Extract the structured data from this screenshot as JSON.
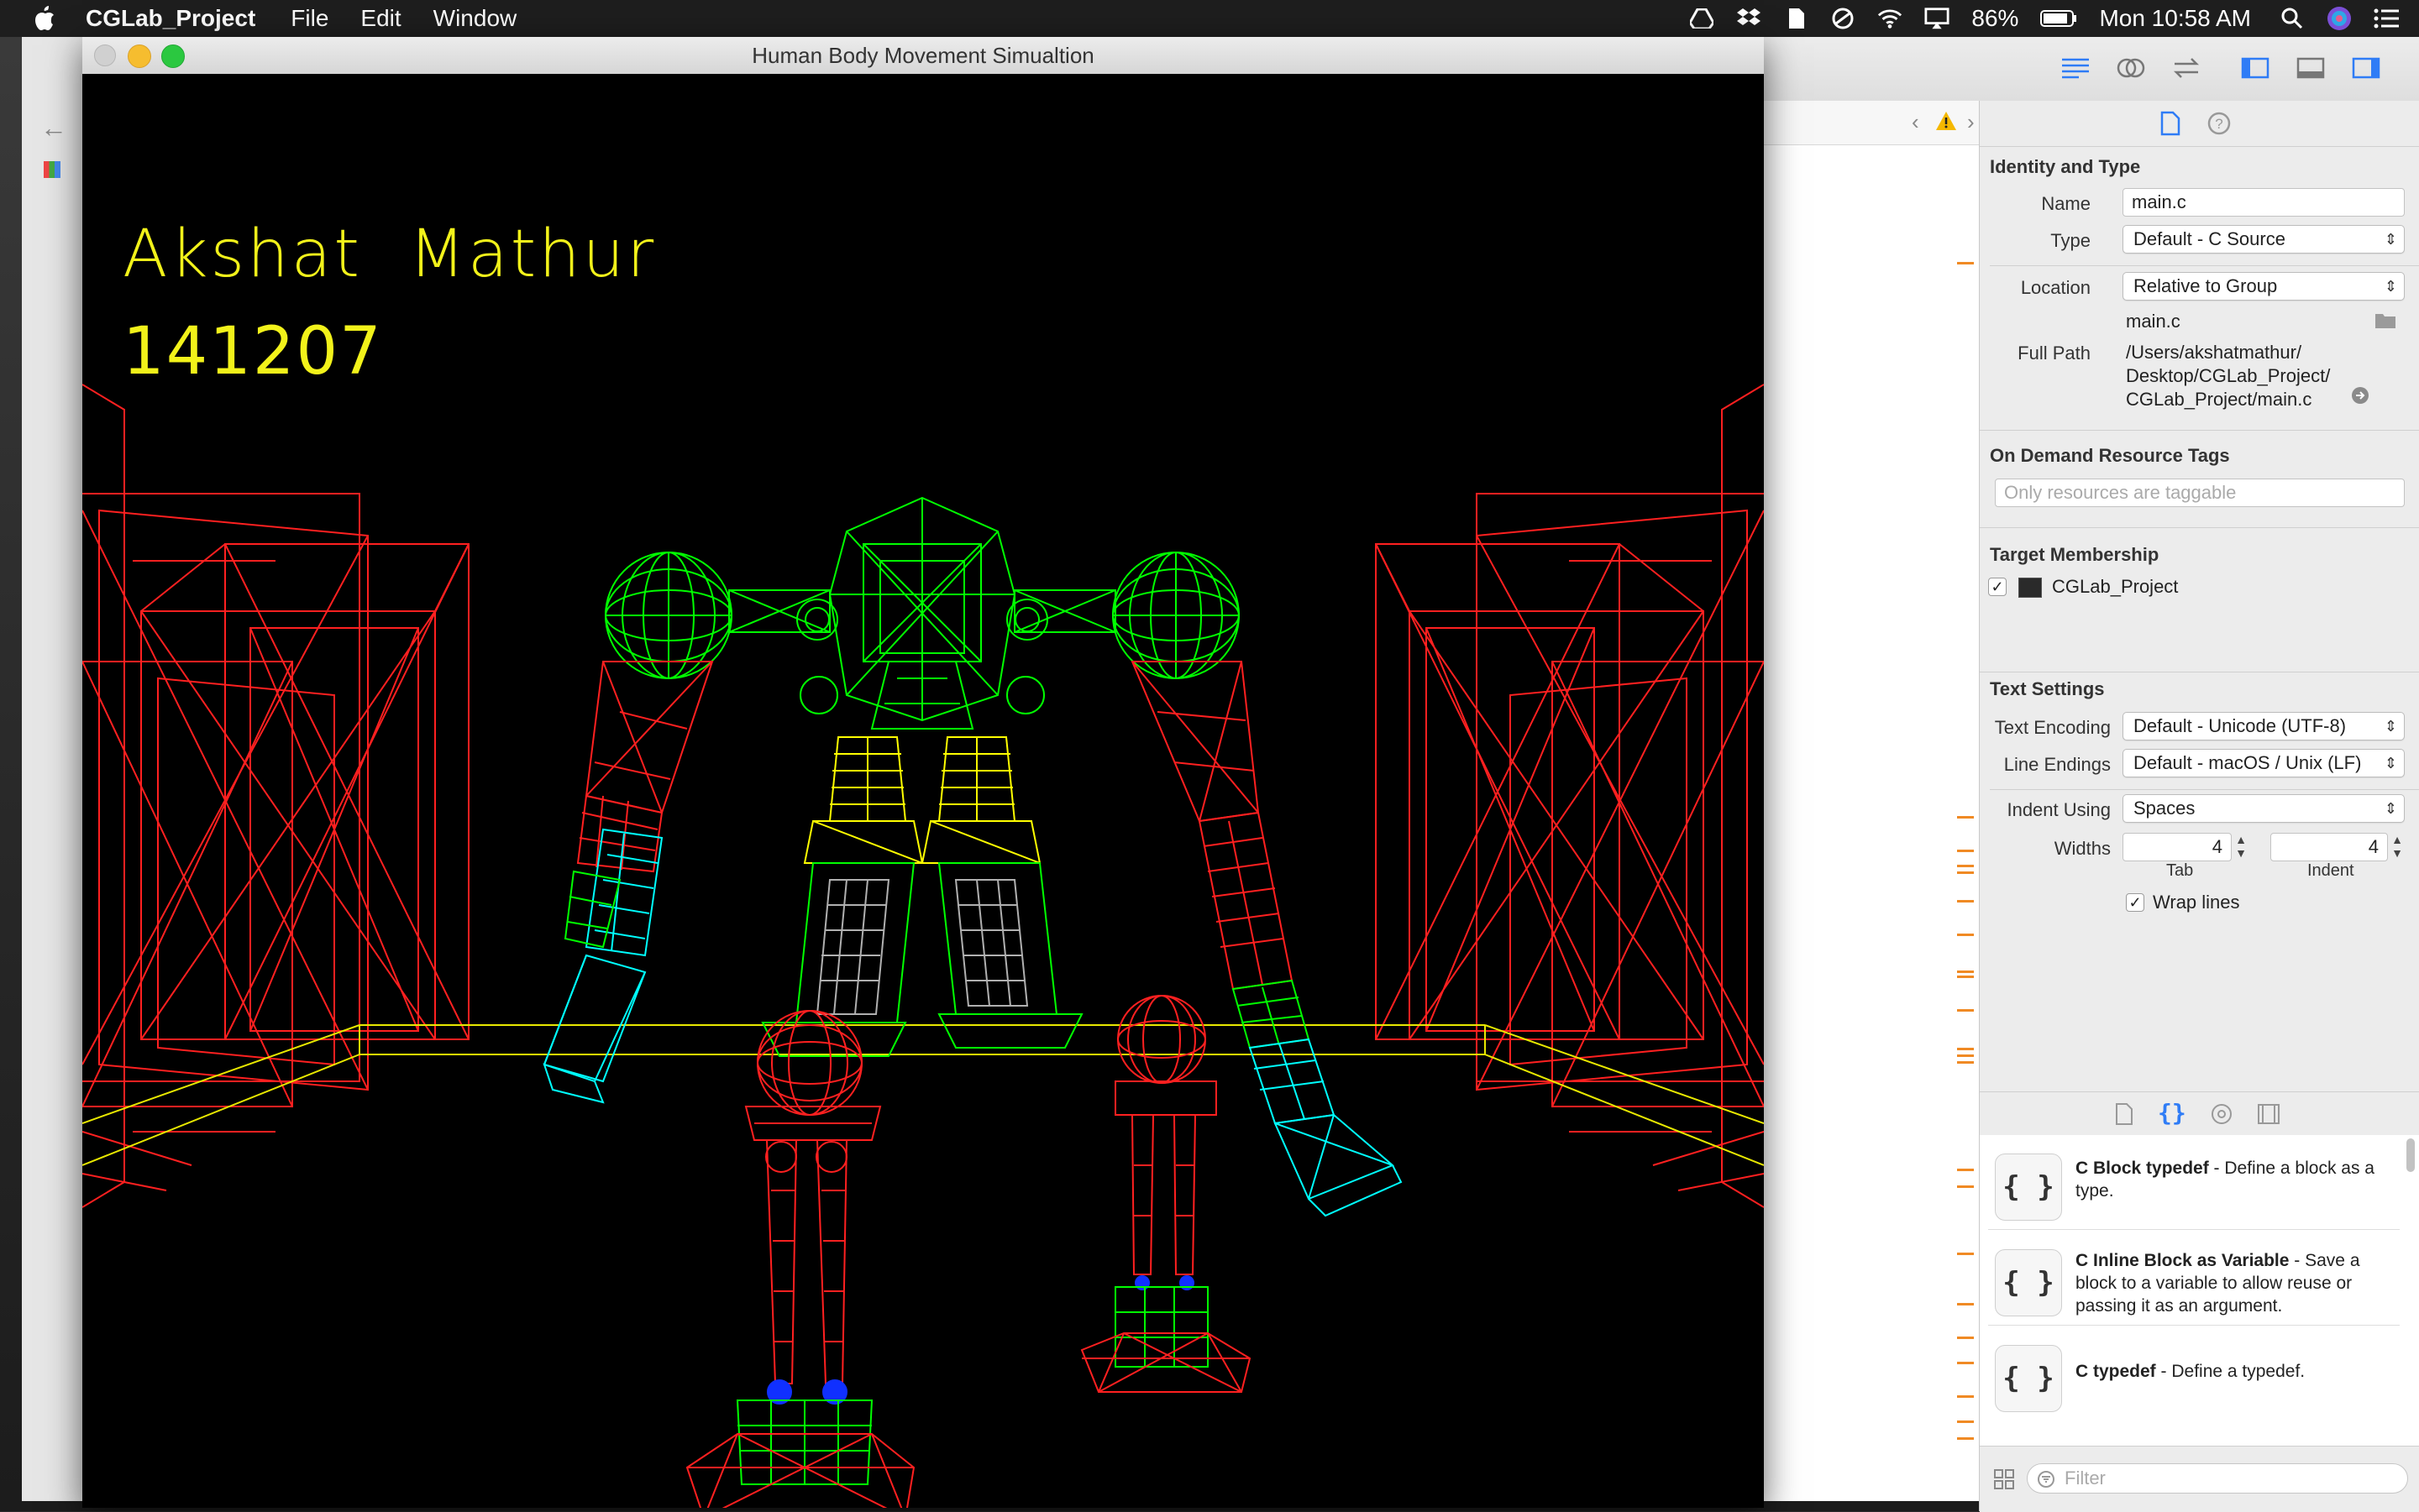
{
  "menubar": {
    "app_name": "CGLab_Project",
    "menus": [
      "File",
      "Edit",
      "Window"
    ],
    "battery": "86%",
    "clock": "Mon 10:58 AM"
  },
  "sim_window": {
    "title": "Human Body Movement Simualtion",
    "overlay_name": "Akshat  Mathur",
    "overlay_id": "141207",
    "colors": {
      "body": "#00ff00",
      "wall": "#ff0000",
      "arm_upper": "#ffff00",
      "cuff": "#00ffff",
      "joint": "#0000ff",
      "grey": "#b0b0b0"
    }
  },
  "inspector": {
    "identity": {
      "title": "Identity and Type",
      "name_label": "Name",
      "name_value": "main.c",
      "type_label": "Type",
      "type_value": "Default - C Source",
      "location_label": "Location",
      "location_value": "Relative to Group",
      "location_file": "main.c",
      "fullpath_label": "Full Path",
      "fullpath_lines": [
        "/Users/akshatmathur/",
        "Desktop/CGLab_Project/",
        "CGLab_Project/main.c"
      ]
    },
    "odr": {
      "title": "On Demand Resource Tags",
      "placeholder": "Only resources are taggable"
    },
    "target": {
      "title": "Target Membership",
      "item": "CGLab_Project"
    },
    "text_settings": {
      "title": "Text Settings",
      "encoding_label": "Text Encoding",
      "encoding_value": "Default - Unicode (UTF-8)",
      "line_endings_label": "Line Endings",
      "line_endings_value": "Default - macOS / Unix (LF)",
      "indent_using_label": "Indent Using",
      "indent_using_value": "Spaces",
      "widths_label": "Widths",
      "tab_value": "4",
      "indent_value": "4",
      "tab_caption": "Tab",
      "indent_caption": "Indent",
      "wrap_label": "Wrap lines"
    },
    "library": [
      {
        "name": "C Block typedef",
        "desc": " - Define a block as a type."
      },
      {
        "name": "C Inline Block as Variable",
        "desc": " - Save a block to a variable to allow reuse or passing it as an argument."
      },
      {
        "name": "C typedef",
        "desc": " - Define a typedef."
      }
    ],
    "filter_placeholder": "Filter"
  }
}
